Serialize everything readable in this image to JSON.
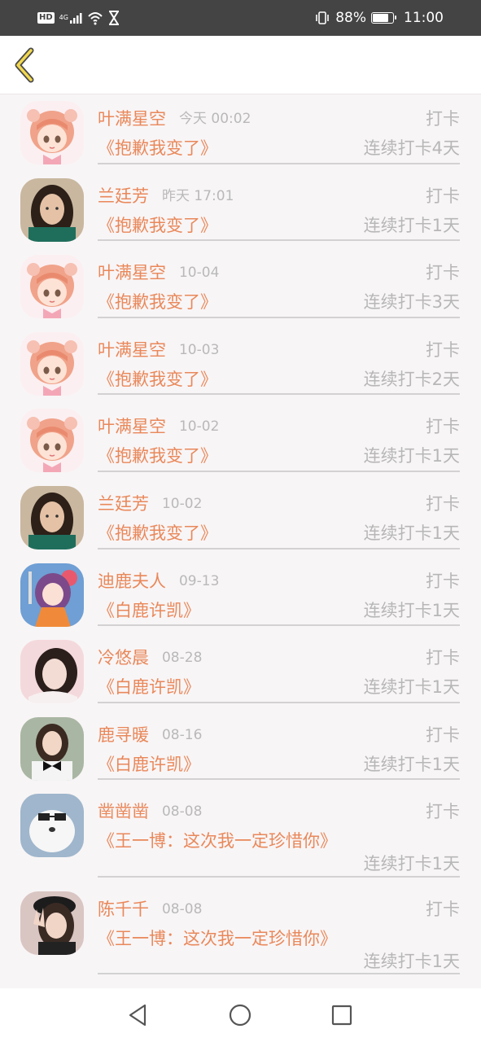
{
  "status_bar": {
    "left_icons": [
      "hd-icon",
      "4g-signal-icon",
      "wifi-icon",
      "hourglass-icon"
    ],
    "hd_label": "HD",
    "network_label": "4G",
    "battery_percent": "88%",
    "battery_level": 0.88,
    "time": "11:00"
  },
  "header": {
    "back_icon": "chevron-left-icon"
  },
  "checkins": [
    {
      "name": "叶满星空",
      "time": "今天 00:02",
      "action": "打卡",
      "book": "《抱歉我变了》",
      "streak": "连续打卡4天",
      "avatar": "anime-girl-pink"
    },
    {
      "name": "兰廷芳",
      "time": "昨天 17:01",
      "action": "打卡",
      "book": "《抱歉我变了》",
      "streak": "连续打卡1天",
      "avatar": "woman-dark-hair"
    },
    {
      "name": "叶满星空",
      "time": "10-04",
      "action": "打卡",
      "book": "《抱歉我变了》",
      "streak": "连续打卡3天",
      "avatar": "anime-girl-pink"
    },
    {
      "name": "叶满星空",
      "time": "10-03",
      "action": "打卡",
      "book": "《抱歉我变了》",
      "streak": "连续打卡2天",
      "avatar": "anime-girl-pink"
    },
    {
      "name": "叶满星空",
      "time": "10-02",
      "action": "打卡",
      "book": "《抱歉我变了》",
      "streak": "连续打卡1天",
      "avatar": "anime-girl-pink"
    },
    {
      "name": "兰廷芳",
      "time": "10-02",
      "action": "打卡",
      "book": "《抱歉我变了》",
      "streak": "连续打卡1天",
      "avatar": "woman-dark-hair"
    },
    {
      "name": "迪鹿夫人",
      "time": "09-13",
      "action": "打卡",
      "book": "《白鹿许凯》",
      "streak": "连续打卡1天",
      "avatar": "anime-girl-purple"
    },
    {
      "name": "冷悠晨",
      "time": "08-28",
      "action": "打卡",
      "book": "《白鹿许凯》",
      "streak": "连续打卡1天",
      "avatar": "woman-pink-bg"
    },
    {
      "name": "鹿寻暖",
      "time": "08-16",
      "action": "打卡",
      "book": "《白鹿许凯》",
      "streak": "连续打卡1天",
      "avatar": "woman-bow-tie"
    },
    {
      "name": "凿凿凿",
      "time": "08-08",
      "action": "打卡",
      "book": "《王一博：这次我一定珍惜你》",
      "streak": "连续打卡1天",
      "avatar": "white-dog-glasses"
    },
    {
      "name": "陈千千",
      "time": "08-08",
      "action": "打卡",
      "book": "《王一博：这次我一定珍惜你》",
      "streak": "连续打卡1天",
      "avatar": "woman-peace-sign"
    }
  ],
  "nav_bar": {
    "back_icon": "triangle-back-icon",
    "home_icon": "circle-home-icon",
    "recents_icon": "square-recents-icon"
  },
  "colors": {
    "accent": "#e9885a",
    "muted_text": "#b7b7b7",
    "divider": "#d3d1d2",
    "background": "#f8f5f6",
    "status_bar": "#444444",
    "back_chevron": "#f2d84f"
  }
}
